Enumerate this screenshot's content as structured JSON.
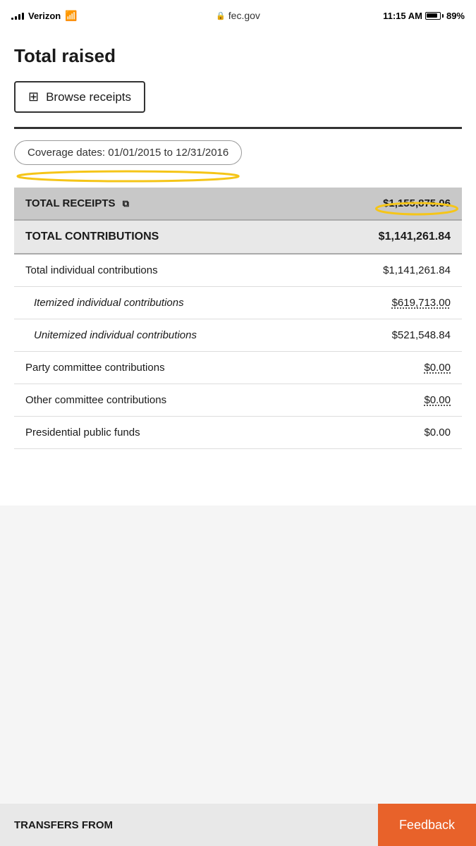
{
  "statusBar": {
    "carrier": "Verizon",
    "time": "11:15 AM",
    "battery": "89%",
    "url": "fec.gov",
    "lock": "🔒"
  },
  "page": {
    "title": "Total raised",
    "browseButton": "Browse receipts",
    "coverageDates": "Coverage dates: 01/01/2015 to 12/31/2016"
  },
  "table": {
    "totalReceiptsLabel": "TOTAL RECEIPTS",
    "totalReceiptsIcon": "📋",
    "totalReceiptsValue": "$1,155,875.06",
    "totalContributionsLabel": "TOTAL CONTRIBUTIONS",
    "totalContributionsValue": "$1,141,261.84",
    "rows": [
      {
        "label": "Total individual contributions",
        "value": "$1,141,261.84",
        "indent": false,
        "italic": false,
        "linked": false
      },
      {
        "label": "Itemized individual contributions",
        "value": "$619,713.00",
        "indent": true,
        "italic": true,
        "linked": true
      },
      {
        "label": "Unitemized individual contributions",
        "value": "$521,548.84",
        "indent": true,
        "italic": true,
        "linked": false
      },
      {
        "label": "Party committee contributions",
        "value": "$0.00",
        "indent": false,
        "italic": false,
        "linked": true
      },
      {
        "label": "Other committee contributions",
        "value": "$0.00",
        "indent": false,
        "italic": false,
        "linked": true
      },
      {
        "label": "Presidential public funds",
        "value": "$0.00",
        "indent": false,
        "italic": false,
        "linked": false
      }
    ]
  },
  "bottomBar": {
    "transfersLabel": "TRANSFERS FROM",
    "feedbackLabel": "Feedback"
  }
}
